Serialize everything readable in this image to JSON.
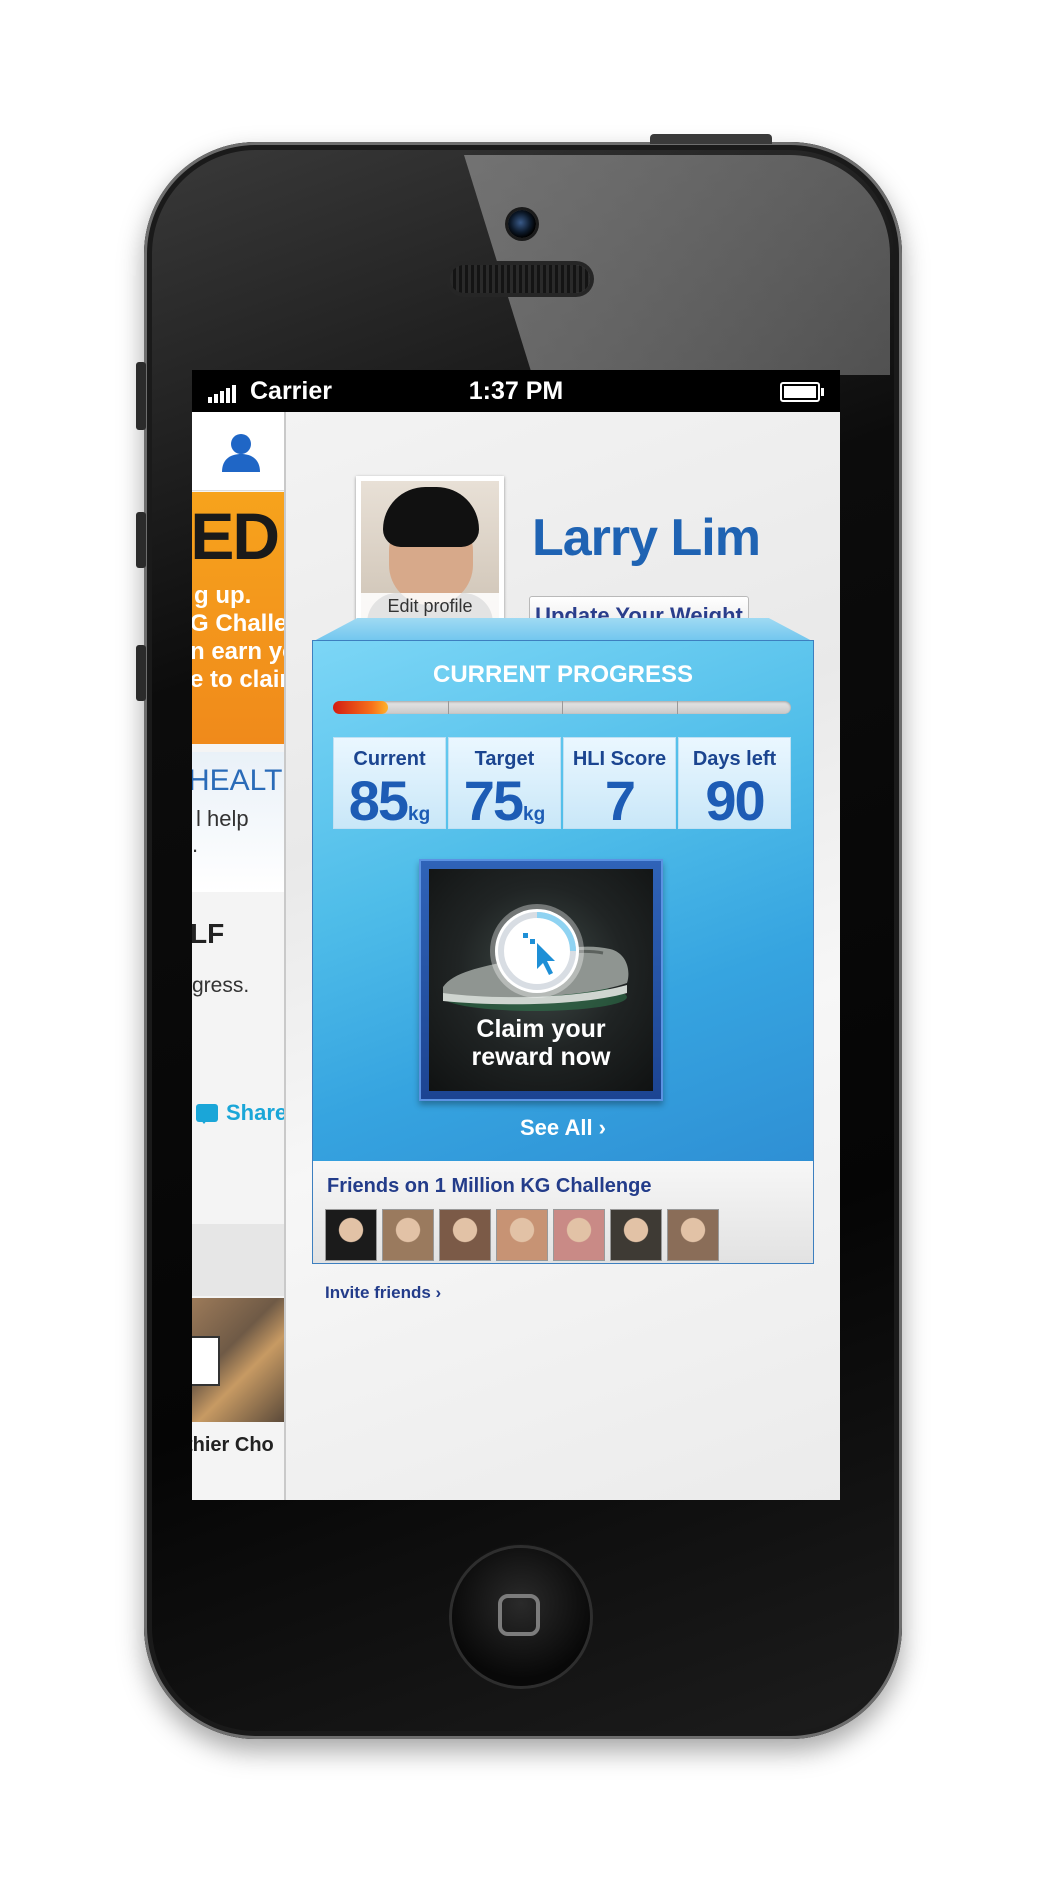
{
  "status_bar": {
    "carrier": "Carrier",
    "time": "1:37 PM"
  },
  "side_menu": {
    "banner_big": "TED",
    "banner_lines": [
      "g up.",
      "G Challeng",
      "n earn you",
      "e to claim."
    ],
    "health_heading": "HEALTH",
    "health_text_1": "l help",
    "health_text_2": ".",
    "section_heading": "LF",
    "section_text": "gress.",
    "share_label": "Share",
    "footer_text": "thier Cho"
  },
  "profile": {
    "name": "Larry Lim",
    "edit_label": "Edit profile",
    "update_weight_label": "Update Your Weight"
  },
  "progress": {
    "title": "CURRENT PROGRESS",
    "fraction": 0.12,
    "stats": [
      {
        "label": "Current",
        "value": "85",
        "unit": "kg"
      },
      {
        "label": "Target",
        "value": "75",
        "unit": "kg"
      },
      {
        "label": "HLI Score",
        "value": "7",
        "unit": ""
      },
      {
        "label": "Days left",
        "value": "90",
        "unit": ""
      }
    ]
  },
  "reward": {
    "line1": "Claim your",
    "line2": "reward now",
    "see_all": "See All ›"
  },
  "friends": {
    "title": "Friends on 1 Million KG Challenge",
    "invite": "Invite friends ›",
    "avatar_colors": [
      "#1b1b1b",
      "#9a7a5e",
      "#7b5a47",
      "#c79374",
      "#c98a86",
      "#3e3a34",
      "#8a6d58"
    ]
  },
  "colors": {
    "accent_blue": "#1f63b3",
    "progress_red": "#d21c12",
    "share_blue": "#1aa6d8"
  }
}
